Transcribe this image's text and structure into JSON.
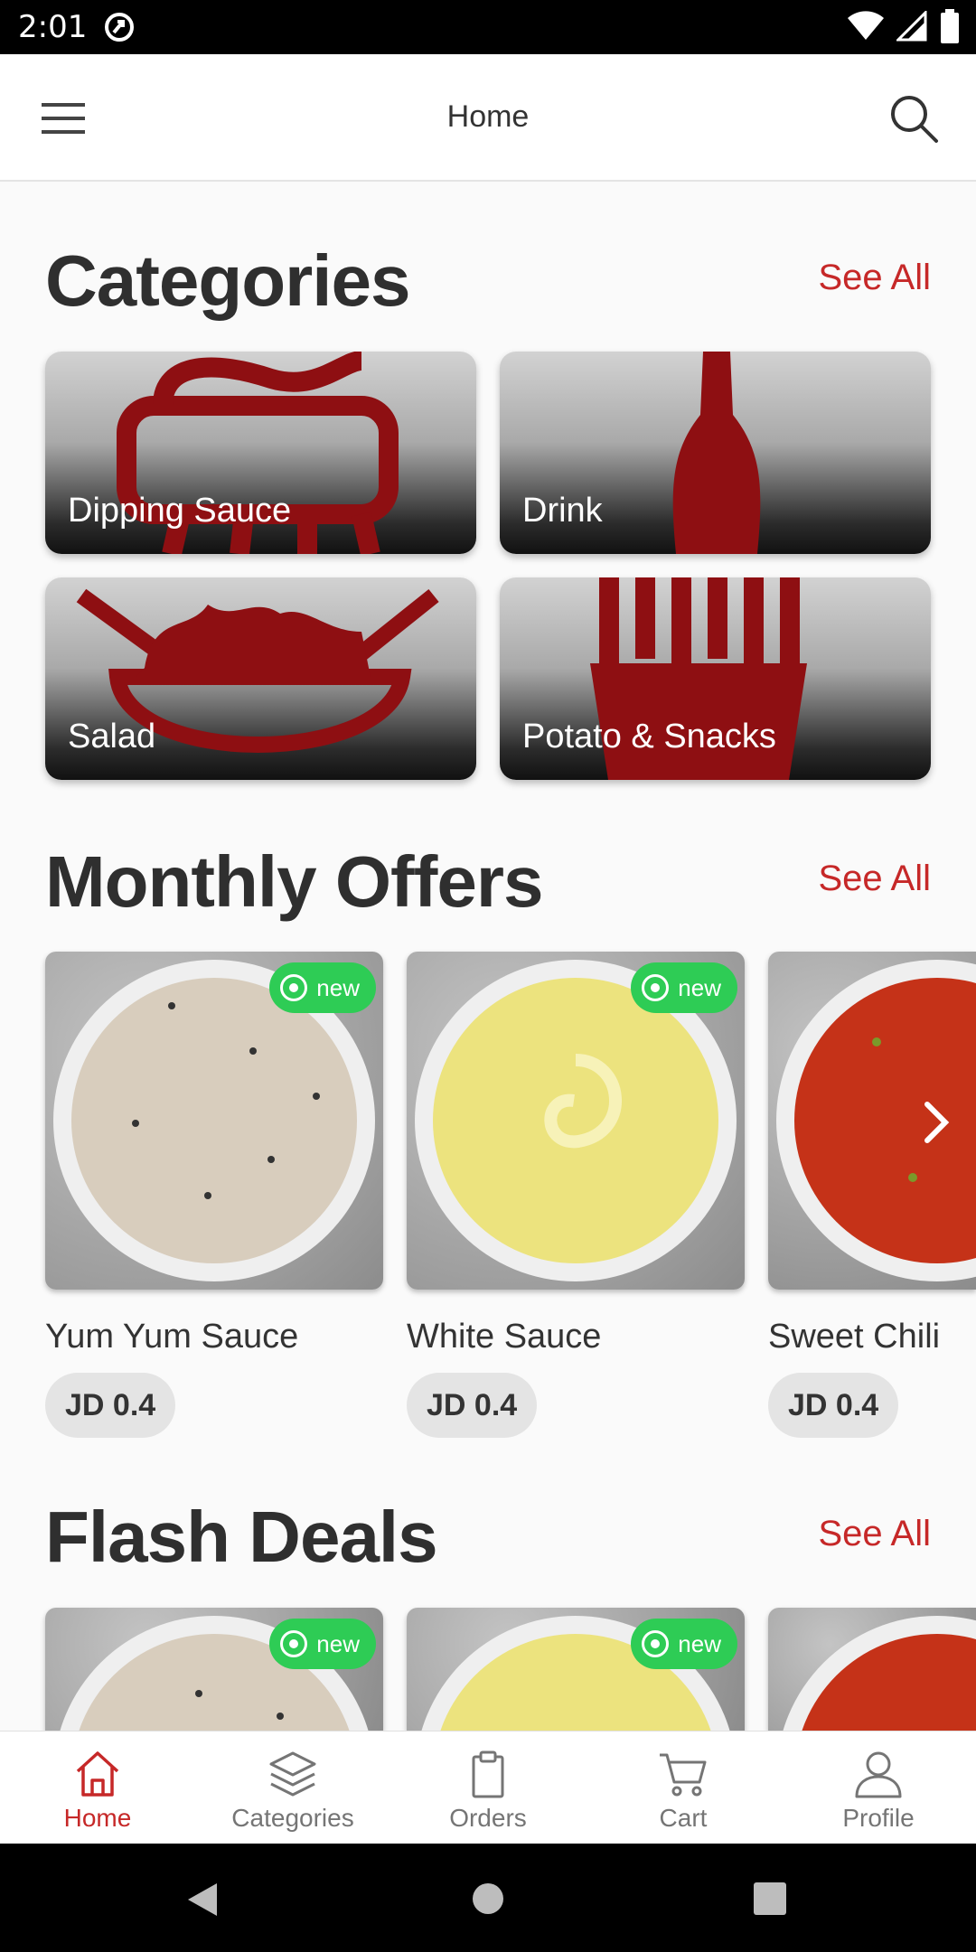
{
  "status": {
    "time": "2:01"
  },
  "appbar": {
    "title": "Home"
  },
  "categories": {
    "title": "Categories",
    "see_all": "See All",
    "items": [
      {
        "label": "Dipping Sauce"
      },
      {
        "label": "Drink"
      },
      {
        "label": "Salad"
      },
      {
        "label": "Potato & Snacks"
      }
    ]
  },
  "monthly_offers": {
    "title": "Monthly Offers",
    "see_all": "See All",
    "items": [
      {
        "name": "Yum Yum Sauce",
        "price": "JD 0.4",
        "badge": "new",
        "sauce_color": "#d8cdbd"
      },
      {
        "name": "White Sauce",
        "price": "JD 0.4",
        "badge": "new",
        "sauce_color": "#ece37e"
      },
      {
        "name": "Sweet Chili",
        "price": "JD 0.4",
        "badge": "",
        "sauce_color": "#c53218"
      }
    ]
  },
  "flash_deals": {
    "title": "Flash Deals",
    "see_all": "See All",
    "items": [
      {
        "badge": "new"
      },
      {
        "badge": "new"
      },
      {
        "badge": ""
      }
    ]
  },
  "bottom_nav": {
    "items": [
      {
        "label": "Home",
        "icon": "home-icon"
      },
      {
        "label": "Categories",
        "icon": "layers-icon"
      },
      {
        "label": "Orders",
        "icon": "clipboard-icon"
      },
      {
        "label": "Cart",
        "icon": "cart-icon"
      },
      {
        "label": "Profile",
        "icon": "person-icon"
      }
    ]
  },
  "colors": {
    "accent": "#c62828",
    "badge": "#2ecc55",
    "category_art": "#8e0f12"
  }
}
